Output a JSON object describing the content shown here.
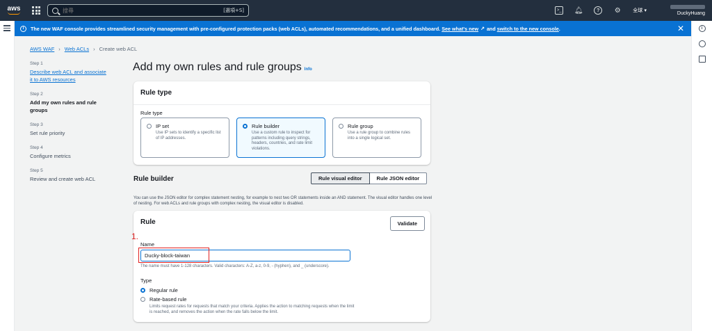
{
  "topnav": {
    "logo": "aws",
    "search_placeholder": "搜尋",
    "search_shortcut": "[選項+S]",
    "region": "全球 ▾",
    "account": "DuckyHuang"
  },
  "banner": {
    "text": "The new WAF console provides streamlined security management with pre-configured protection packs (web ACLs), automated recommendations, and a unified dashboard.",
    "link1": "See what's new",
    "and": "and",
    "link2": "switch to the new console",
    "period": "."
  },
  "breadcrumb": [
    "AWS WAF",
    "Web ACLs",
    "Create web ACL"
  ],
  "steps": [
    {
      "num": "Step 1",
      "title": "Describe web ACL and associate it to AWS resources"
    },
    {
      "num": "Step 2",
      "title": "Add my own rules and rule groups"
    },
    {
      "num": "Step 3",
      "title": "Set rule priority"
    },
    {
      "num": "Step 4",
      "title": "Configure metrics"
    },
    {
      "num": "Step 5",
      "title": "Review and create web ACL"
    }
  ],
  "page": {
    "title": "Add my own rules and rule groups",
    "info": "Info"
  },
  "rule_type": {
    "header": "Rule type",
    "label": "Rule type",
    "options": [
      {
        "title": "IP set",
        "desc": "Use IP sets to identify a specific list of IP addresses."
      },
      {
        "title": "Rule builder",
        "desc": "Use a custom rule to inspect for patterns including query strings, headers, countries, and rate limit violations."
      },
      {
        "title": "Rule group",
        "desc": "Use a rule group to combine rules into a single logical set."
      }
    ]
  },
  "rule_builder": {
    "title": "Rule builder",
    "visual_editor": "Rule visual editor",
    "json_editor": "Rule JSON editor",
    "help": "You can use the JSON editor for complex statement nesting, for example to nest two OR statements inside an AND statement. The visual editor handles one level of nesting. For web ACLs and rule groups with complex nesting, the visual editor is disabled."
  },
  "rule": {
    "header": "Rule",
    "validate": "Validate",
    "name_label": "Name",
    "name_value": "Ducky-block-taiwan",
    "name_hint": "The name must have 1-128 characters. Valid characters: A-Z, a-z, 0-9, - (hyphen), and _ (underscore).",
    "type_label": "Type",
    "regular": "Regular rule",
    "rate": "Rate-based rule",
    "rate_desc": "Limits request rates for requests that match your criteria. Applies the action to matching requests when the limit is reached, and removes the action when the rate falls below the limit."
  },
  "annotation": {
    "number": "1."
  }
}
